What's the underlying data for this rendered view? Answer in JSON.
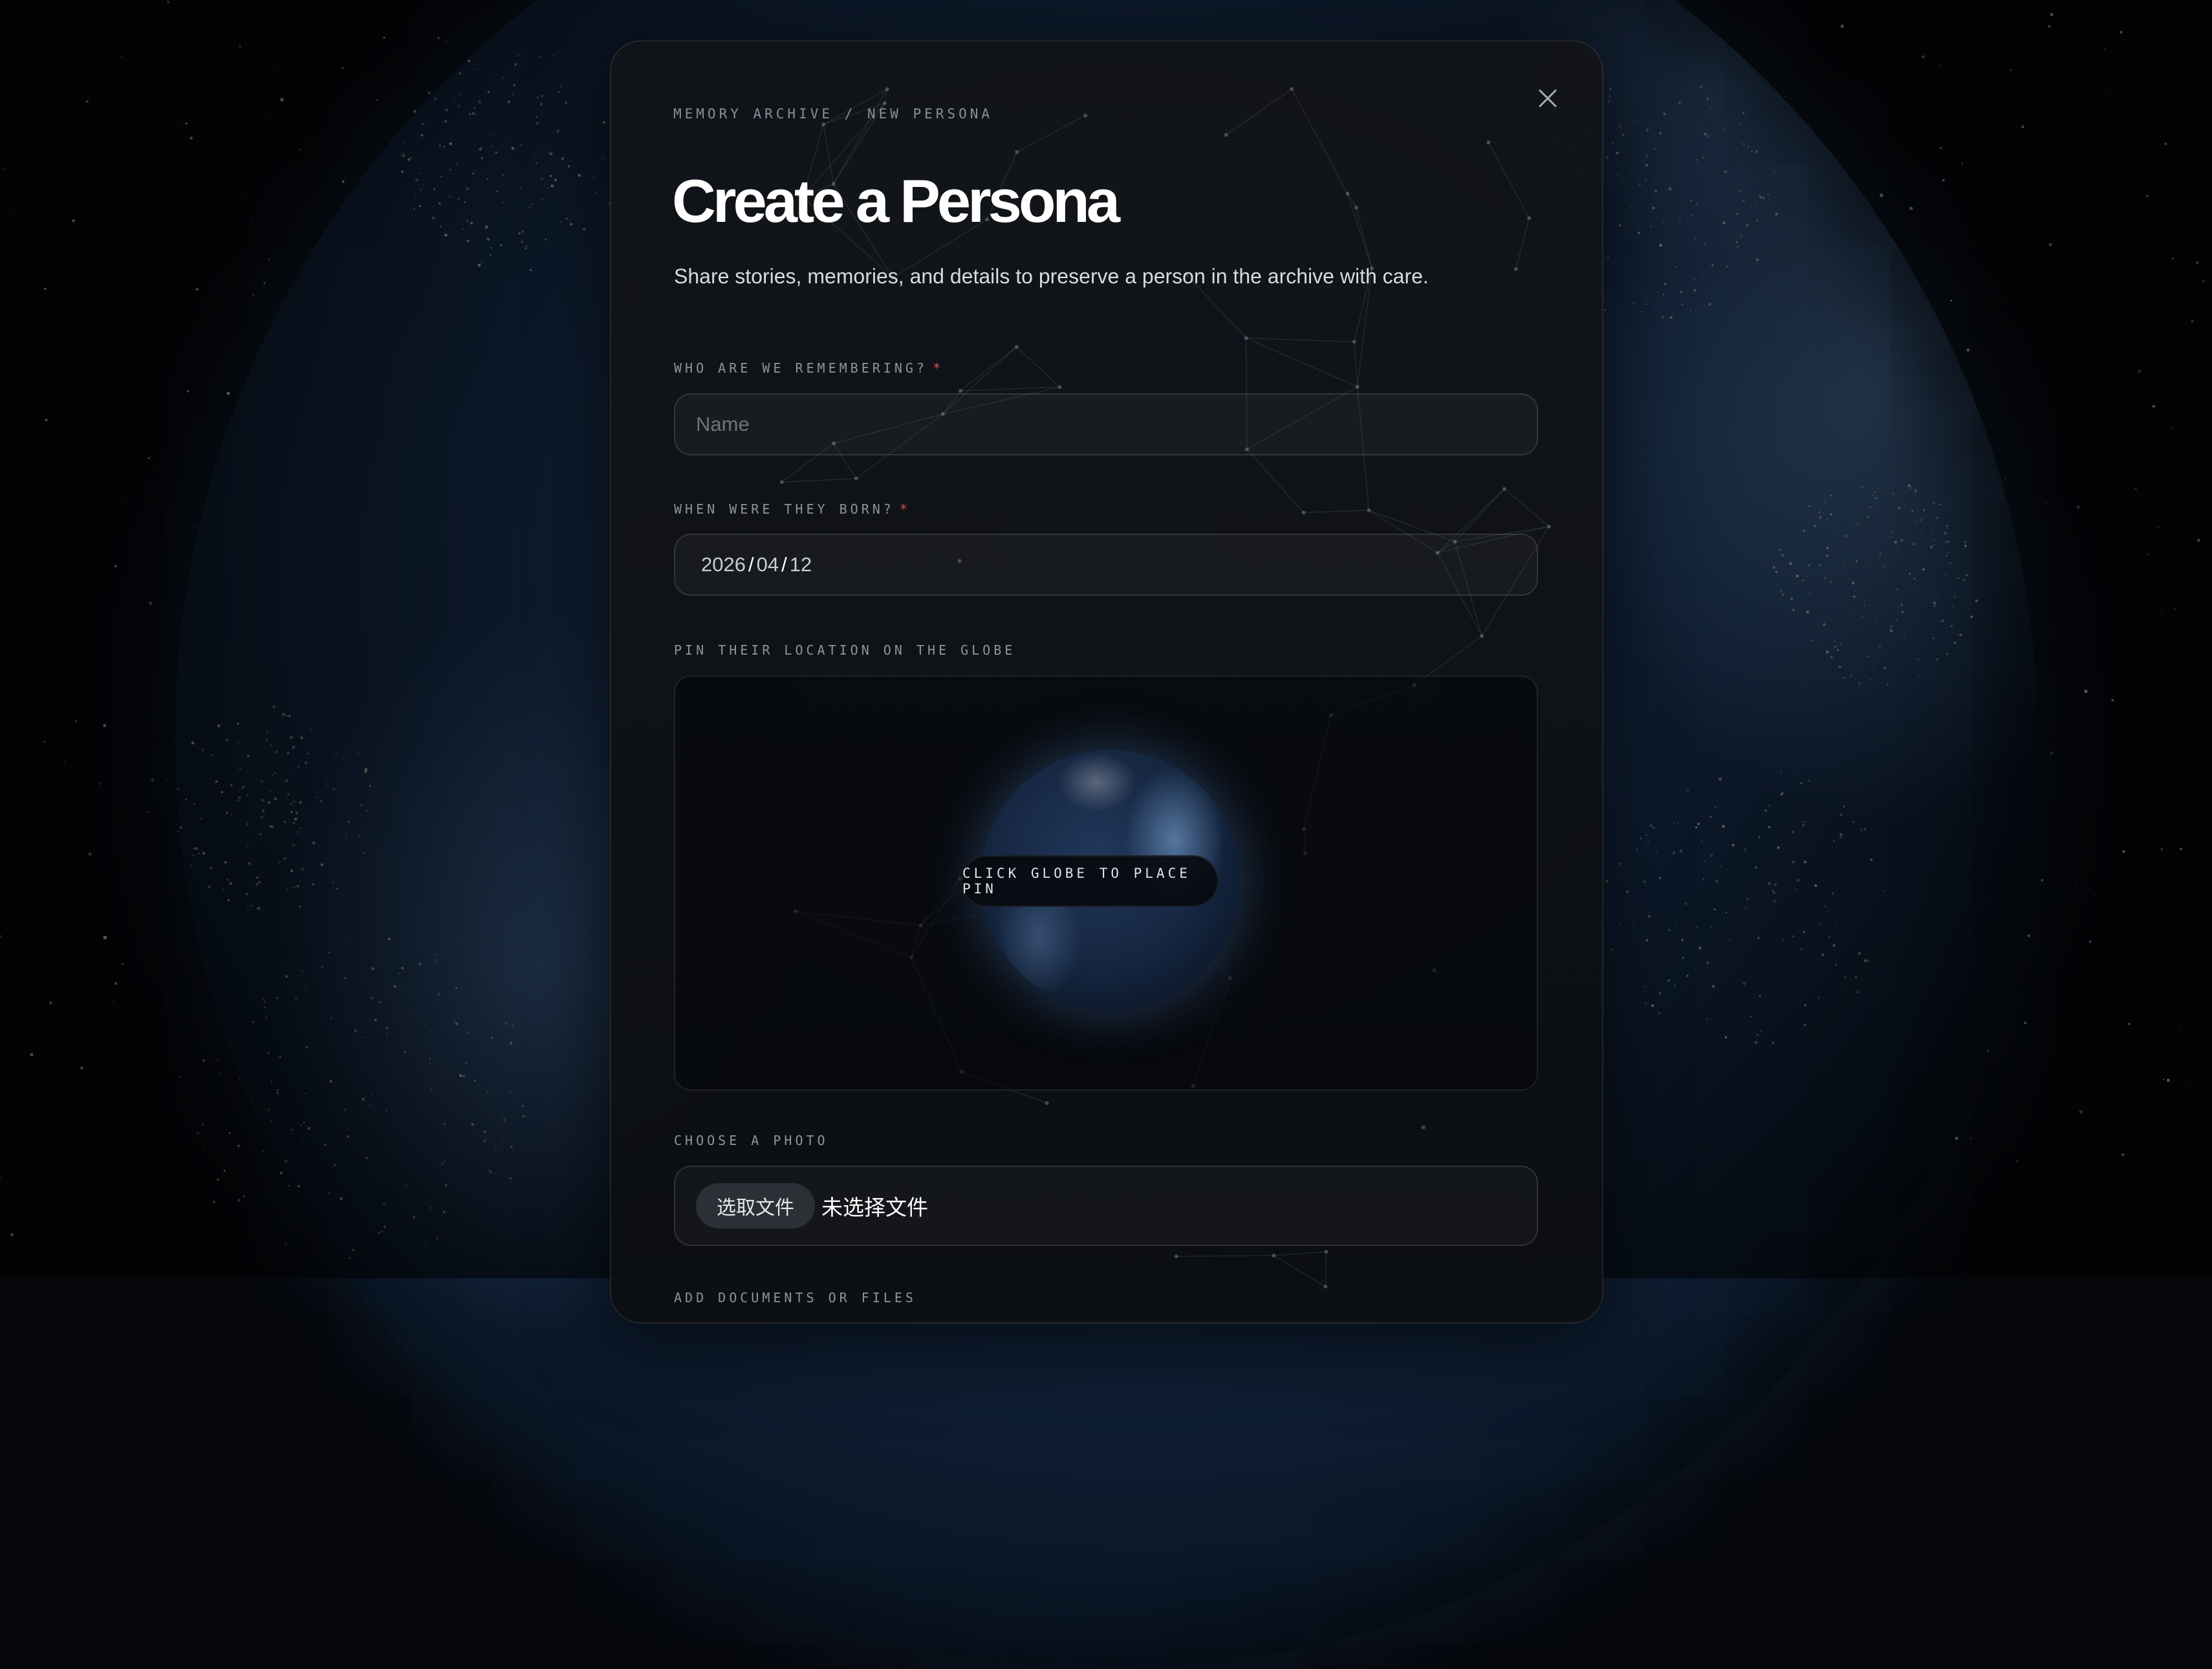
{
  "modal": {
    "breadcrumb": "MEMORY ARCHIVE / NEW PERSONA",
    "title": "Create a Persona",
    "subtitle": "Share stories, memories, and details to preserve a person in the archive with care.",
    "close_icon": "close-icon"
  },
  "form": {
    "name": {
      "label": "WHO ARE WE REMEMBERING?",
      "required_mark": "*",
      "placeholder": "Name",
      "value": ""
    },
    "birth": {
      "label": "WHEN WERE THEY BORN?",
      "required_mark": "*",
      "year": "2026",
      "month": "04",
      "day": "12",
      "separator": "/"
    },
    "location": {
      "label": "PIN THEIR LOCATION ON THE GLOBE",
      "hint": "CLICK GLOBE TO PLACE PIN"
    },
    "photo": {
      "label": "CHOOSE A PHOTO",
      "button_label": "选取文件",
      "status": "未选择文件"
    },
    "documents": {
      "label": "ADD DOCUMENTS OR FILES"
    }
  },
  "colors": {
    "required": "#e04b57",
    "background": "#05070b",
    "accent_globe": "#1b2e4c"
  }
}
